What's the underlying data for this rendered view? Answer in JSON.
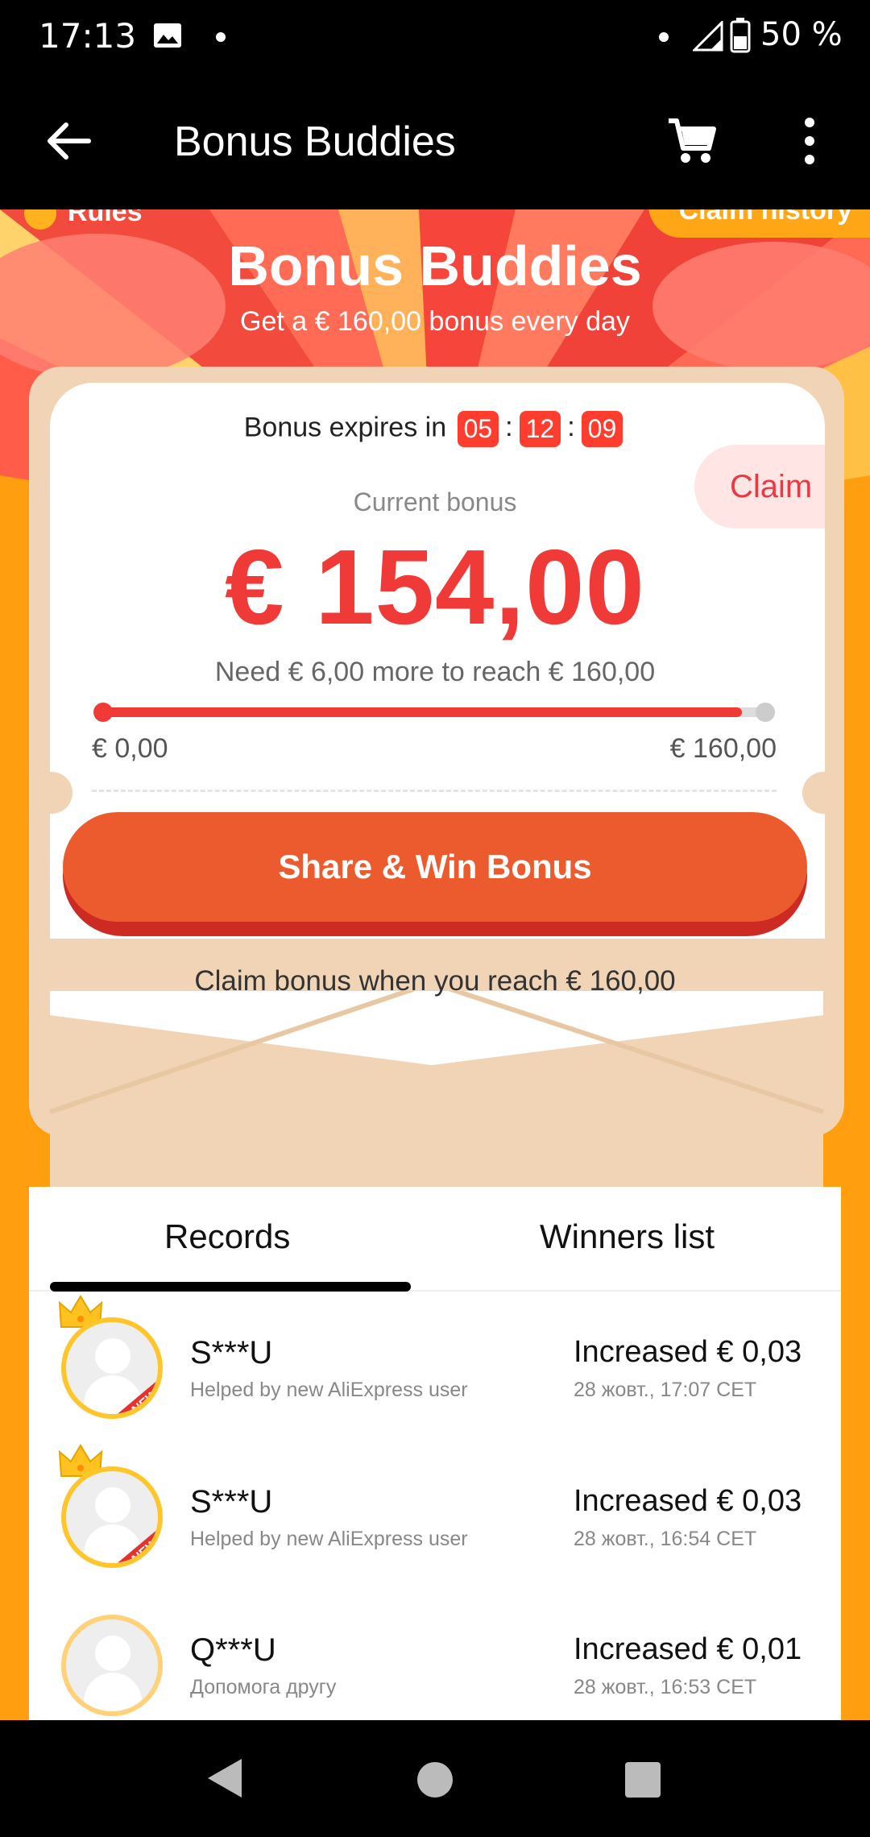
{
  "status_bar": {
    "time": "17:13",
    "battery": "50 %"
  },
  "app_bar": {
    "title": "Bonus Buddies"
  },
  "hero": {
    "rules_label": "Rules",
    "claim_history_label": "Claim history",
    "title": "Bonus Buddies",
    "subtitle": "Get a € 160,00 bonus every day"
  },
  "bonus_card": {
    "expires_label": "Bonus expires in",
    "timer": {
      "hours": "05",
      "minutes": "12",
      "seconds": "09",
      "separator": ":"
    },
    "claim_label": "Claim",
    "current_label": "Current bonus",
    "amount": "€ 154,00",
    "need_text": "Need € 6,00 more to reach € 160,00",
    "progress_fraction": 0.9625,
    "range_min": "€ 0,00",
    "range_max": "€ 160,00",
    "share_button": "Share & Win Bonus",
    "claim_hint": "Claim bonus when you reach € 160,00"
  },
  "tabs": [
    {
      "label": "Records",
      "active": true
    },
    {
      "label": "Winners list",
      "active": false
    }
  ],
  "records": [
    {
      "name": "S***U",
      "description": "Helped by new AliExpress user",
      "increase": "Increased € 0,03",
      "date": "28 жовт., 17:07 CET",
      "crown": true,
      "new_badge": "NEW"
    },
    {
      "name": "S***U",
      "description": "Helped by new AliExpress user",
      "increase": "Increased € 0,03",
      "date": "28 жовт., 16:54 CET",
      "crown": true,
      "new_badge": "NEW"
    },
    {
      "name": "Q***U",
      "description": "Допомога другу",
      "increase": "Increased € 0,01",
      "date": "28 жовт., 16:53 CET",
      "crown": false,
      "new_badge": ""
    }
  ],
  "colors": {
    "accent": "#f03a38",
    "background": "#ff9f10",
    "button": "#ec5b2e"
  }
}
